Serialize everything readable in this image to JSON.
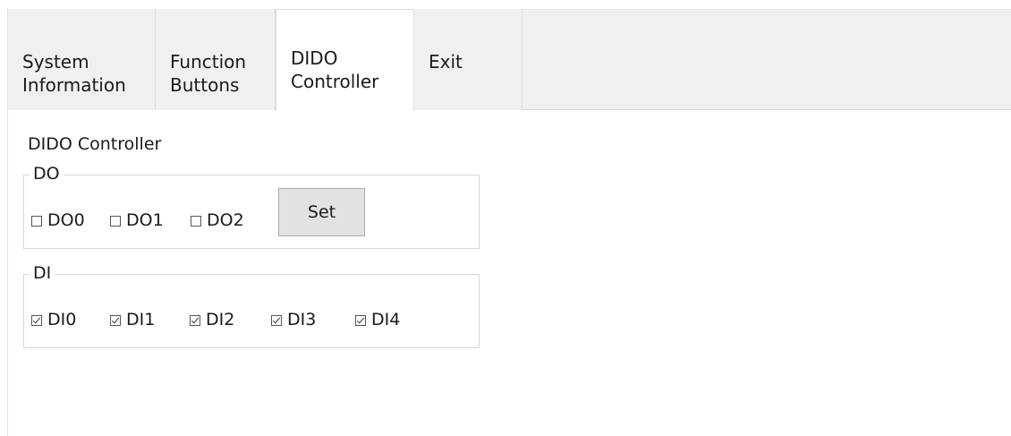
{
  "tabs": [
    {
      "line1": "System",
      "line2": "Information"
    },
    {
      "line1": "Function",
      "line2": "Buttons"
    },
    {
      "line1": "DIDO",
      "line2": "Controller"
    },
    {
      "line1": "Exit",
      "line2": ""
    }
  ],
  "active_tab": "DIDO Controller",
  "panel": {
    "title": "DIDO Controller",
    "do_group": {
      "legend": "DO",
      "outputs": [
        {
          "label": "DO0",
          "checked": false
        },
        {
          "label": "DO1",
          "checked": false
        },
        {
          "label": "DO2",
          "checked": false
        }
      ],
      "set_label": "Set"
    },
    "di_group": {
      "legend": "DI",
      "inputs": [
        {
          "label": "DI0",
          "checked": true
        },
        {
          "label": "DI1",
          "checked": true
        },
        {
          "label": "DI2",
          "checked": true
        },
        {
          "label": "DI3",
          "checked": true
        },
        {
          "label": "DI4",
          "checked": true
        }
      ]
    }
  },
  "colors": {
    "tab_background": "#f0f0f0",
    "active_tab_background": "#ffffff",
    "button_background": "#e2e2e2"
  }
}
